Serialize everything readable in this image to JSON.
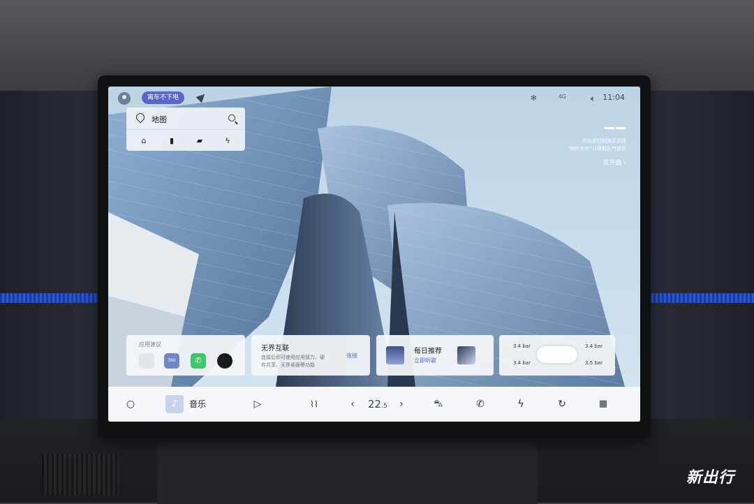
{
  "status": {
    "mode_pill": "离车不下电",
    "time": "11:04",
    "network": "4G"
  },
  "map_card": {
    "title": "地图",
    "shortcuts": [
      "home-icon",
      "office-icon",
      "favorite-icon",
      "charging-icon"
    ]
  },
  "weather": {
    "line1": "开启定位权限并选择",
    "line2": "“始终允许”以获取天气信息",
    "action": "去开启 ›"
  },
  "app_suggest": {
    "title": "应用建议",
    "apps": [
      "car-app-icon",
      "video-call-icon",
      "phone-app-icon",
      "camera-app-icon"
    ],
    "video_badge": "360"
  },
  "connect_card": {
    "title": "无界互联",
    "desc1": "连接后即可使用应用接力、硬",
    "desc2": "件共享、无界桌面等功能",
    "action": "连接"
  },
  "music_card": {
    "title": "每日推荐",
    "action": "立即听歌"
  },
  "tire_card": {
    "fl": "3.4 bar",
    "fr": "3.4 bar",
    "rl": "3.4 bar",
    "rr": "3.5 bar"
  },
  "dock": {
    "music_label": "音乐",
    "temp_main": "22",
    "temp_dec": ".5",
    "prev": "‹",
    "next": "›"
  },
  "watermark": "新出行",
  "colors": {
    "accent": "#5b66c8",
    "link": "#4b6ad0",
    "phone_green": "#3ec76a"
  }
}
